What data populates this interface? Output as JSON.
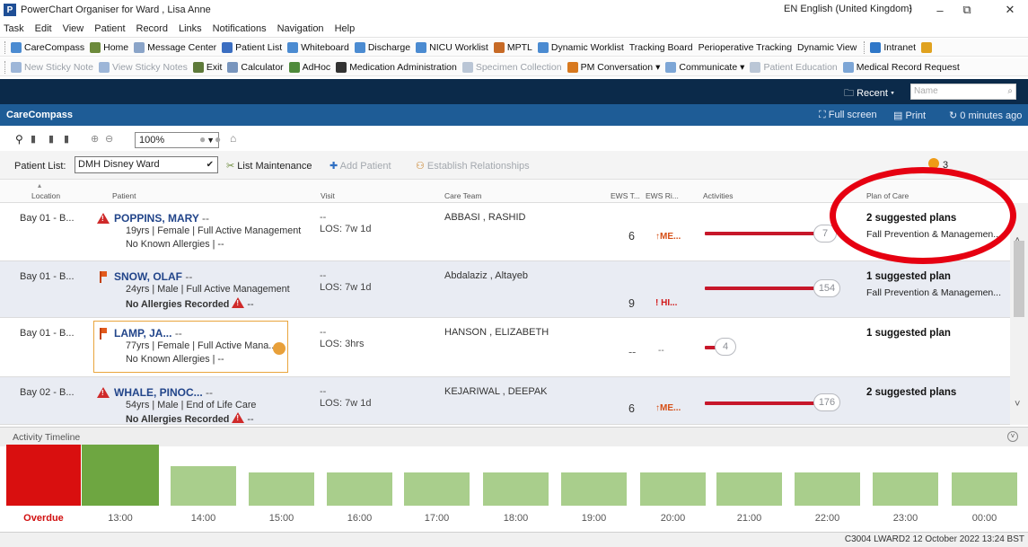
{
  "window": {
    "title": "PowerChart Organiser for Ward , Lisa Anne",
    "language": "EN English (United Kingdom)",
    "minimize": "–",
    "restore": "⧉",
    "close": "✕"
  },
  "menu": [
    "Task",
    "Edit",
    "View",
    "Patient",
    "Record",
    "Links",
    "Notifications",
    "Navigation",
    "Help"
  ],
  "toolbar1": [
    "CareCompass",
    "Home",
    "Message Center",
    "Patient List",
    "Whiteboard",
    "Discharge",
    "NICU Worklist",
    "MPTL",
    "Dynamic Worklist",
    "Tracking Board",
    "Perioperative Tracking",
    "Dynamic View",
    "Intranet"
  ],
  "toolbar2": [
    "New Sticky Note",
    "View Sticky Notes",
    "Exit",
    "Calculator",
    "AdHoc",
    "Medication Administration",
    "Specimen Collection",
    "PM Conversation",
    "Communicate",
    "Patient Education",
    "Medical Record Request"
  ],
  "recent": {
    "label": "Recent ▾",
    "name_placeholder": "Name"
  },
  "carecompass": {
    "title": "CareCompass",
    "fullscreen": "Full screen",
    "print": "Print",
    "refresh": "0 minutes ago"
  },
  "zoom": "100%",
  "patient_list": {
    "label": "Patient List:",
    "value": "DMH Disney Ward",
    "list_maintenance": "List Maintenance",
    "add_patient": "Add Patient",
    "establish": "Establish Relationships",
    "alert_count": "3"
  },
  "columns": {
    "location": "Location",
    "patient": "Patient",
    "visit": "Visit",
    "care_team": "Care Team",
    "ews_t": "EWS T...",
    "ews_r": "EWS Ri...",
    "activities": "Activities",
    "plan": "Plan of Care"
  },
  "patients": [
    {
      "location": "Bay 01 - B...",
      "name": "POPPINS, MARY",
      "name_suffix": "--",
      "info": "19yrs | Female | Full Active Management",
      "allergy": "No Known Allergies",
      "allergy_suffix": "| --",
      "visit": "--",
      "los": "LOS: 7w 1d",
      "team": "ABBASI , RASHID",
      "ews": "6",
      "ews_risk": "ME...",
      "activity": "7",
      "plan": "2 suggested plans",
      "plan_detail": "Fall Prevention & Managemen..."
    },
    {
      "location": "Bay 01 - B...",
      "name": "SNOW, OLAF",
      "name_suffix": "--",
      "info": "24yrs | Male | Full Active Management",
      "allergy": "No Allergies Recorded",
      "allergy_suffix": "--",
      "visit": "--",
      "los": "LOS: 7w 1d",
      "team": "Abdalaziz , Altayeb",
      "ews": "9",
      "ews_risk": "HI...",
      "activity": "154",
      "plan": "1 suggested plan",
      "plan_detail": "Fall Prevention & Managemen..."
    },
    {
      "location": "Bay 01 - B...",
      "name": "LAMP, JA...",
      "name_suffix": "--",
      "info": "77yrs | Female | Full Active Mana...",
      "allergy": "No Known Allergies",
      "allergy_suffix": "| --",
      "visit": "--",
      "los": "LOS: 3hrs",
      "team": "HANSON , ELIZABETH",
      "ews": "--",
      "ews_risk": "--",
      "activity": "4",
      "plan": "1 suggested plan",
      "plan_detail": ""
    },
    {
      "location": "Bay 02 - B...",
      "name": "WHALE, PINOC...",
      "name_suffix": "--",
      "info": "54yrs | Male | End of Life Care",
      "allergy": "No Allergies Recorded",
      "allergy_suffix": "--",
      "visit": "--",
      "los": "LOS: 7w 1d",
      "team": "KEJARIWAL , DEEPAK",
      "ews": "6",
      "ews_risk": "ME...",
      "activity": "176",
      "plan": "2 suggested plans",
      "plan_detail": ""
    }
  ],
  "timeline": {
    "title": "Activity Timeline",
    "labels": [
      "Overdue",
      "13:00",
      "14:00",
      "15:00",
      "16:00",
      "17:00",
      "18:00",
      "19:00",
      "20:00",
      "21:00",
      "22:00",
      "23:00",
      "00:00"
    ],
    "colors": {
      "overdue": "#d90f0f",
      "current": "#6ea641",
      "future": "#a9ce8c"
    }
  },
  "status": "C3004  LWARD2  12 October 2022  13:24 BST",
  "colors": {
    "header": "#1e5c96",
    "topbar": "#0b2a4a",
    "annotation": "#e60011"
  }
}
